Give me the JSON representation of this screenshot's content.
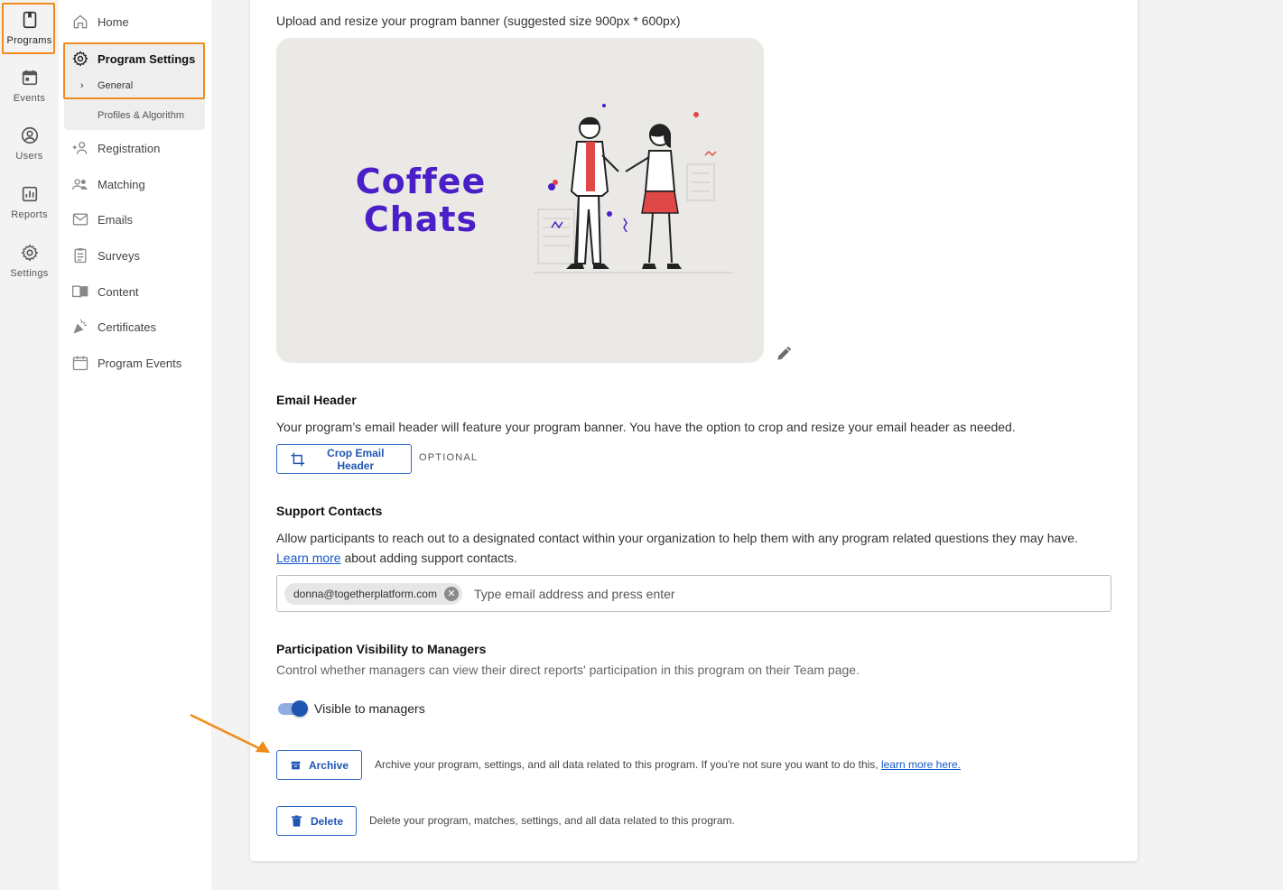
{
  "rail": {
    "items": [
      {
        "label": "Programs",
        "icon": "bookmark-icon"
      },
      {
        "label": "Events",
        "icon": "calendar-icon"
      },
      {
        "label": "Users",
        "icon": "user-circle-icon"
      },
      {
        "label": "Reports",
        "icon": "bar-chart-icon"
      },
      {
        "label": "Settings",
        "icon": "gear-icon"
      }
    ]
  },
  "nav": {
    "home": "Home",
    "program_settings": "Program Settings",
    "general": "General",
    "profiles": "Profiles & Algorithm",
    "registration": "Registration",
    "matching": "Matching",
    "emails": "Emails",
    "surveys": "Surveys",
    "content": "Content",
    "certificates": "Certificates",
    "program_events": "Program Events"
  },
  "banner": {
    "instruction": "Upload and resize your program banner (suggested size 900px * 600px)",
    "title_line1": "Coffee",
    "title_line2": "Chats"
  },
  "email_header": {
    "heading": "Email Header",
    "description": "Your program’s email header will feature your program banner. You have the option to crop and resize your email header as needed.",
    "button_label": "Crop Email Header",
    "optional_label": "OPTIONAL"
  },
  "support_contacts": {
    "heading": "Support Contacts",
    "description_start": "Allow participants to reach out to a designated contact within your organization to help them with any program related questions they may have. ",
    "learn_more": "Learn more",
    "description_end": " about adding support contacts.",
    "chip": "donna@togetherplatform.com",
    "input_placeholder": "Type email address and press enter"
  },
  "visibility": {
    "heading": "Participation Visibility to Managers",
    "description": "Control whether managers can view their direct reports' participation in this program on their Team page.",
    "toggle_label": "Visible to managers",
    "toggle_on": true
  },
  "archive": {
    "button_label": "Archive",
    "description": "Archive your program, settings, and all data related to this program. If you’re not sure you want to do this, ",
    "link": "learn more here."
  },
  "delete": {
    "button_label": "Delete",
    "description": "Delete your program, matches, settings, and all data related to this program."
  },
  "colors": {
    "accent": "#1e55b3",
    "highlight": "#f08c1a",
    "banner_title": "#4a1fc8"
  }
}
